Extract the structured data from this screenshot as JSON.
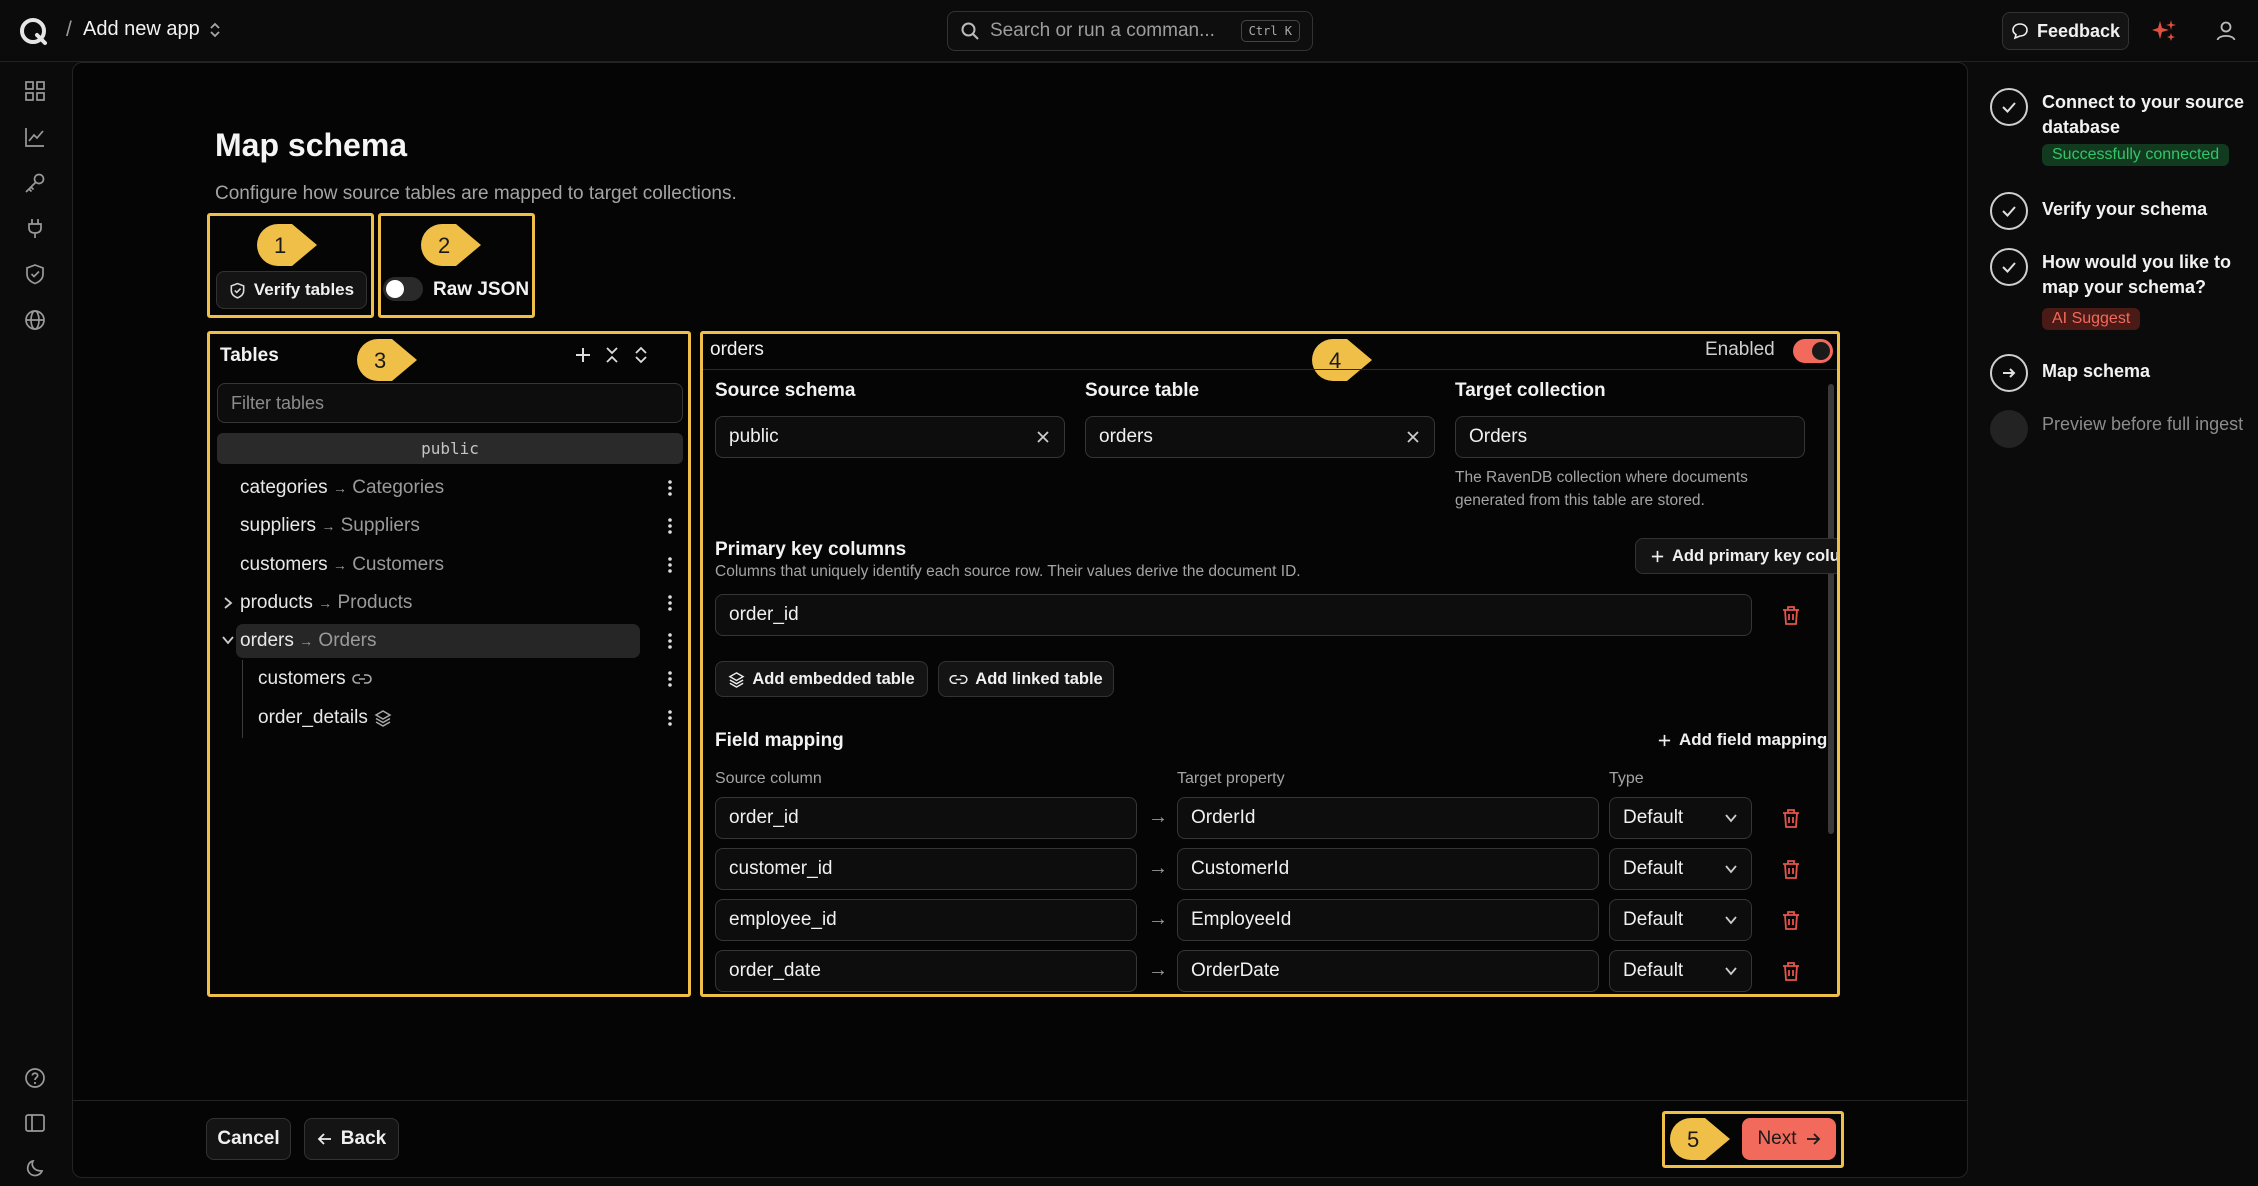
{
  "topbar": {
    "separator": "/",
    "app_title": "Add new app",
    "search_placeholder": "Search or run a comman...",
    "search_shortcut": "Ctrl K",
    "feedback_label": "Feedback"
  },
  "page": {
    "title": "Map schema",
    "description": "Configure how source tables are mapped to target collections.",
    "verify_tables_label": "Verify tables",
    "raw_json_label": "Raw JSON",
    "raw_json_enabled": false
  },
  "callouts": [
    "1",
    "2",
    "3",
    "4",
    "5"
  ],
  "tables_panel": {
    "title": "Tables",
    "filter_placeholder": "Filter tables",
    "schema_group": "public",
    "arrow": "→",
    "items": [
      {
        "source": "categories",
        "target": "Categories"
      },
      {
        "source": "suppliers",
        "target": "Suppliers"
      },
      {
        "source": "customers",
        "target": "Customers"
      },
      {
        "source": "products",
        "target": "Products"
      },
      {
        "source": "orders",
        "target": "Orders"
      }
    ],
    "children": [
      {
        "name": "customers",
        "icon": "link-icon"
      },
      {
        "name": "order_details",
        "icon": "layers-icon"
      }
    ]
  },
  "editor": {
    "table_name": "orders",
    "enabled_label": "Enabled",
    "enabled": true,
    "source_schema_label": "Source schema",
    "source_schema_value": "public",
    "source_table_label": "Source table",
    "source_table_value": "orders",
    "target_collection_label": "Target collection",
    "target_collection_value": "Orders",
    "target_collection_help": "The RavenDB collection where documents generated from this table are stored.",
    "pk_title": "Primary key columns",
    "pk_description": "Columns that uniquely identify each source row. Their values derive the document ID.",
    "add_pk_label": "Add primary key column",
    "pk_value": "order_id",
    "add_embedded_label": "Add embedded table",
    "add_linked_label": "Add linked table",
    "field_mapping_title": "Field mapping",
    "add_field_mapping_label": "Add field mapping",
    "col_source": "Source column",
    "col_target": "Target property",
    "col_type": "Type",
    "arrow": "→",
    "mappings": [
      {
        "source": "order_id",
        "target": "OrderId",
        "type": "Default"
      },
      {
        "source": "customer_id",
        "target": "CustomerId",
        "type": "Default"
      },
      {
        "source": "employee_id",
        "target": "EmployeeId",
        "type": "Default"
      },
      {
        "source": "order_date",
        "target": "OrderDate",
        "type": "Default"
      }
    ]
  },
  "footer": {
    "cancel_label": "Cancel",
    "back_label": "Back",
    "next_label": "Next"
  },
  "steps": [
    {
      "label": "Connect to your source database",
      "status": "done",
      "badge": "Successfully connected"
    },
    {
      "label": "Verify your schema",
      "status": "done"
    },
    {
      "label": "How would you like to map your schema?",
      "status": "done",
      "badge": "AI Suggest"
    },
    {
      "label": "Map schema",
      "status": "current"
    },
    {
      "label": "Preview before full ingest",
      "status": "pending"
    }
  ],
  "colors": {
    "accent": "#f26a5b",
    "callout": "#f0bf47",
    "success": "#35c46a",
    "danger": "#e5544b"
  }
}
